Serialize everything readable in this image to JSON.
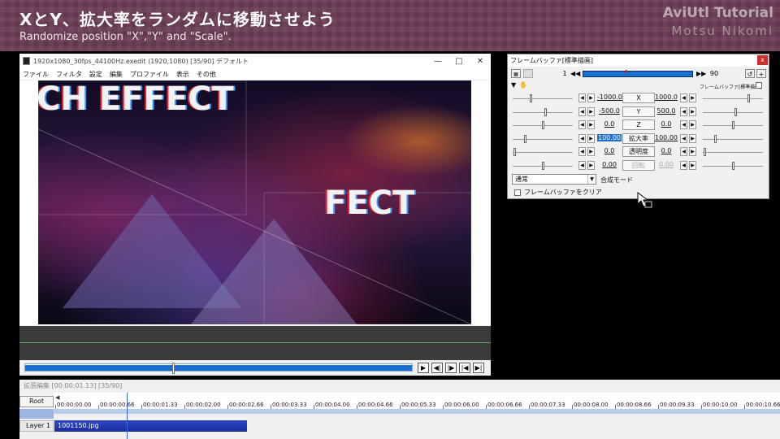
{
  "banner": {
    "title": "XとY、拡大率をランダムに移動させよう",
    "subtitle": "Randomize position \"X\",\"Y\" and \"Scale\".",
    "brand": "AviUtl Tutorial",
    "author": "Motsu Nikomi"
  },
  "main_window": {
    "title": "1920x1080_30fps_44100Hz.exedit (1920,1080)  [35/90]  デフォルト",
    "controls": {
      "min": "—",
      "max": "□",
      "close": "✕"
    },
    "menu": [
      "ファイル",
      "フィルタ",
      "設定",
      "編集",
      "プロファイル",
      "表示",
      "その他"
    ],
    "effect_text_1": "CH EFFECT",
    "effect_text_2": "FECT",
    "seek_progress": 0.38,
    "playback": {
      "play": "▶",
      "prev_frame": "◀|",
      "next_frame": "|▶",
      "to_start": "|◀",
      "to_end": "▶|"
    }
  },
  "dialog": {
    "title": "フレームバッファ[標準描画]",
    "close": "x",
    "frame_start": "1",
    "frame_end": "90",
    "frame_progress": 0.38,
    "section_label": "フレームバッファ[標準描画]",
    "params": [
      {
        "name": "X",
        "left": "-1000.0",
        "right": "1000.0",
        "lpos": 0.3,
        "rpos": 0.78,
        "enabled": true,
        "selected": false
      },
      {
        "name": "Y",
        "left": "-500.0",
        "right": "500.0",
        "lpos": 0.55,
        "rpos": 0.55,
        "enabled": true,
        "selected": false
      },
      {
        "name": "Z",
        "left": "0.0",
        "right": "0.0",
        "lpos": 0.5,
        "rpos": 0.5,
        "enabled": true,
        "selected": false
      },
      {
        "name": "拡大率",
        "left": "100.00",
        "right": "100.00",
        "lpos": 0.2,
        "rpos": 0.2,
        "enabled": true,
        "selected": true
      },
      {
        "name": "透明度",
        "left": "0.0",
        "right": "0.0",
        "lpos": 0.02,
        "rpos": 0.02,
        "enabled": true,
        "selected": false
      },
      {
        "name": "回転",
        "left": "0.00",
        "right": "0.00",
        "lpos": 0.5,
        "rpos": 0.5,
        "enabled": false,
        "selected": false
      }
    ],
    "blend_mode_value": "通常",
    "blend_mode_label": "合成モード",
    "clear_checkbox_label": "フレームバッファをクリア"
  },
  "timeline": {
    "title": "拡張編集 [00:00:01.13] [35/90]",
    "root_label": "Root",
    "layer_label": "Layer 1",
    "clip_label": "1001150.jpg",
    "ticks": [
      "00:00:00.00",
      "00:00:00.66",
      "00:00:01.33",
      "00:00:02.00",
      "00:00:02.66",
      "00:00:03.33",
      "00:00:04.00",
      "00:00:04.66",
      "00:00:05.33",
      "00:00:06.00",
      "00:00:06.66",
      "00:00:07.33",
      "00:00:08.00",
      "00:00:08.66",
      "00:00:09.33",
      "00:00:10.00",
      "00:00:10.66"
    ]
  },
  "colors": {
    "banner": "#6b3c55",
    "accent_blue": "#1a6fd1",
    "clip": "#2f48c4"
  }
}
